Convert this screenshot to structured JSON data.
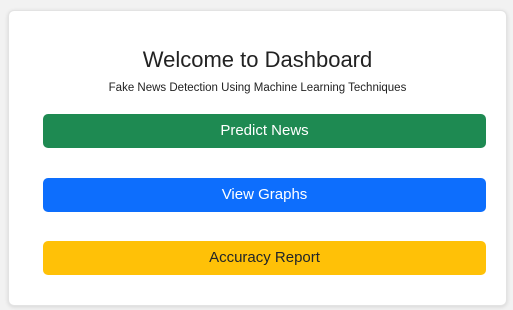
{
  "dashboard": {
    "title": "Welcome to Dashboard",
    "subtitle": "Fake News Detection Using Machine Learning Techniques"
  },
  "buttons": [
    {
      "label": "Predict News",
      "color": "#1e8a52",
      "text_color": "#ffffff"
    },
    {
      "label": "View Graphs",
      "color": "#0d6efd",
      "text_color": "#ffffff"
    },
    {
      "label": "Accuracy Report",
      "color": "#ffc107",
      "text_color": "#212529"
    }
  ]
}
